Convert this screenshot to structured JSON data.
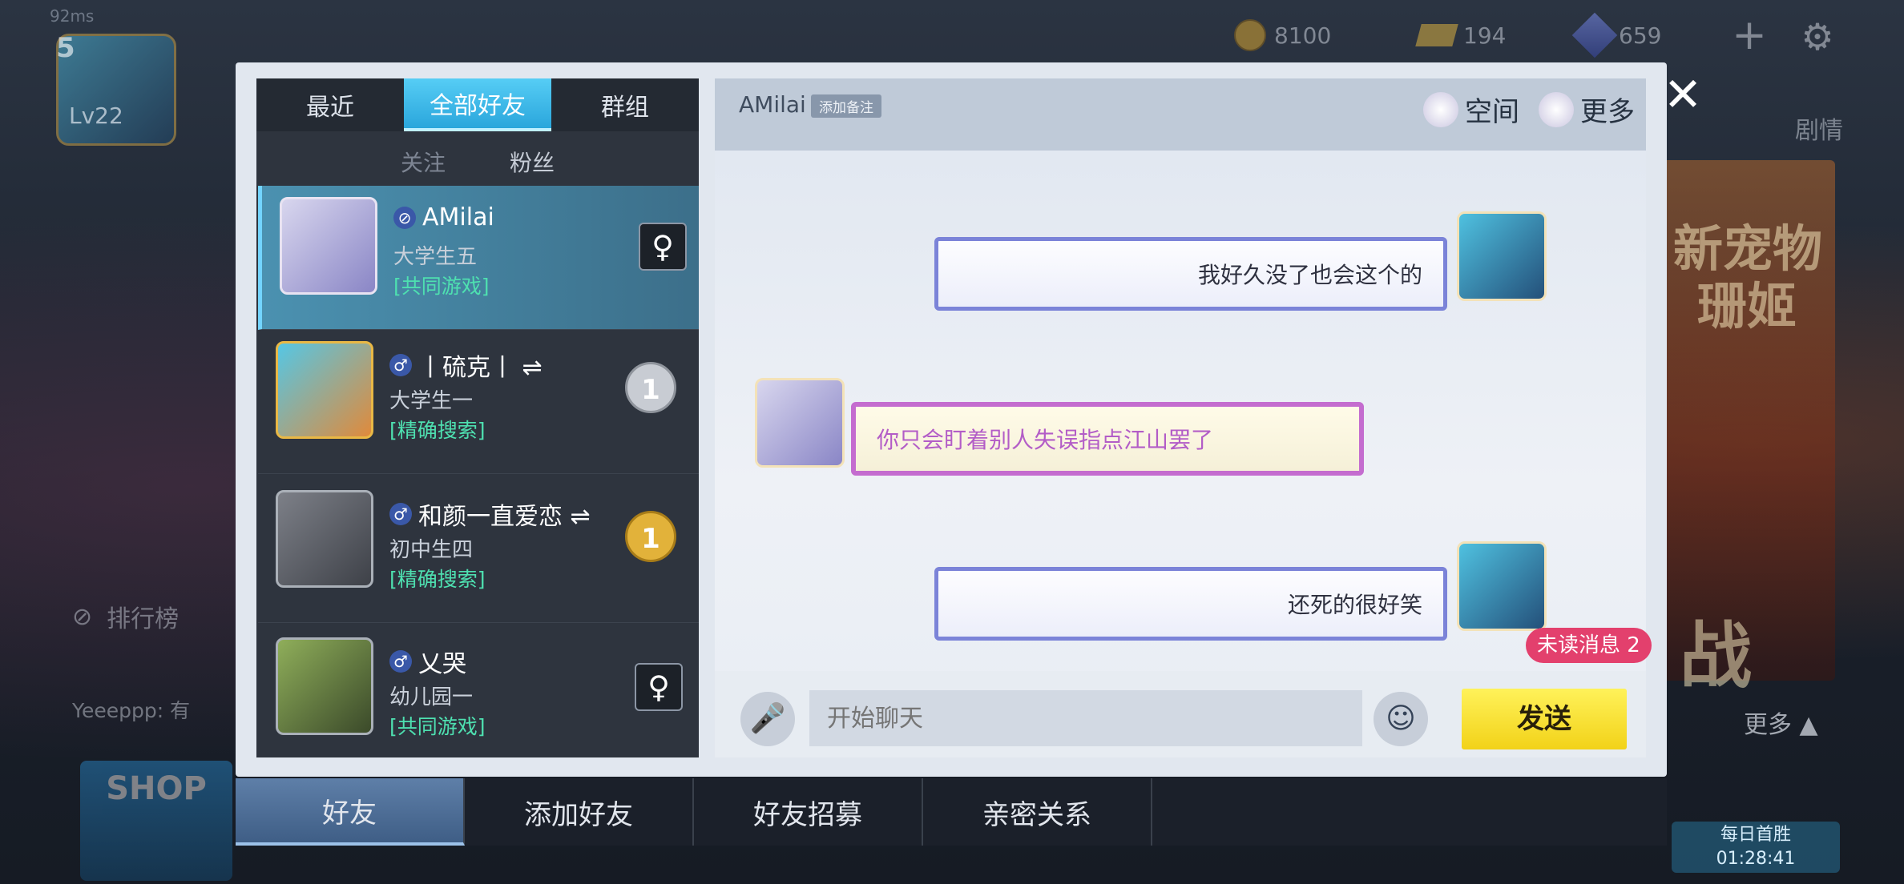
{
  "hud": {
    "network": "92ms",
    "level_num": "5",
    "level_label": "Lv22",
    "coins": "8100",
    "gold": "194",
    "gems": "659"
  },
  "background": {
    "rank_label": "排行榜",
    "feed_text": "Yeeeppp: 有",
    "story_label": "剧情",
    "poster_line1": "新宠物",
    "poster_line2": "珊姬",
    "poster_line3": "战",
    "more_label": "更多 ▲",
    "daily_label": "每日首胜",
    "daily_timer": "01:28:41",
    "shop_label": "SHOP"
  },
  "friend_panel": {
    "tabs": [
      "最近",
      "全部好友",
      "群组"
    ],
    "subtabs": [
      "关注",
      "粉丝"
    ],
    "friends": [
      {
        "name": "AMilai",
        "grade": "大学生五",
        "tag": "[共同游戏]",
        "gender": "⊘"
      },
      {
        "name": "丨硫克丨 ⇌",
        "grade": "大学生一",
        "tag": "[精确搜索]",
        "gender": "♂"
      },
      {
        "name": "和颜一直爱恋 ⇌",
        "grade": "初中生四",
        "tag": "[精确搜索]",
        "gender": "♂"
      },
      {
        "name": "乂哭",
        "grade": "幼儿园一",
        "tag": "[共同游戏]",
        "gender": "♂"
      }
    ]
  },
  "chat": {
    "name": "AMilai",
    "remark_btn": "添加备注",
    "space_btn": "空间",
    "more_btn": "更多",
    "messages": [
      {
        "side": "right",
        "text": "我好久没了也会这个的"
      },
      {
        "side": "left",
        "text": "你只会盯着别人失误指点江山罢了"
      },
      {
        "side": "right",
        "text": "还死的很好笑"
      }
    ],
    "unread": "未读消息 2",
    "input_placeholder": "开始聊天",
    "send": "发送"
  },
  "bottom_tabs": [
    "好友",
    "添加好友",
    "好友招募",
    "亲密关系"
  ],
  "colors": {
    "accent_blue": "#2aa6dc",
    "send_yellow": "#f2d218",
    "tag_green": "#4ee0b0",
    "unread_red": "#e3406d"
  }
}
